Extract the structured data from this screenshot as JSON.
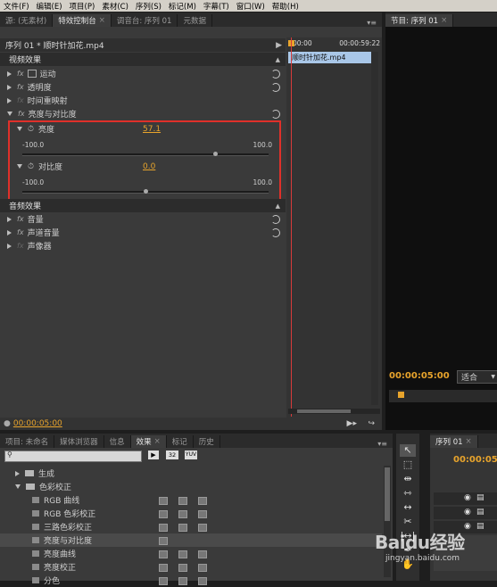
{
  "menu": [
    "文件(F)",
    "编辑(E)",
    "项目(P)",
    "素材(C)",
    "序列(S)",
    "标记(M)",
    "字幕(T)",
    "窗口(W)",
    "帮助(H)"
  ],
  "top_tabs": {
    "source": "源: (无素材)",
    "effect_controls": "特效控制台",
    "mixer": "调音台: 序列 01",
    "metadata": "元数据"
  },
  "program_tab": "节目: 序列 01",
  "effect_controls": {
    "clip_title": "序列 01 * 顺时针加花.mp4",
    "timecode_start": "00:00",
    "timecode_end": "00:00:59:22",
    "clip_bar_label": "顺时针加花.mp4",
    "video_header": "视频效果",
    "effects": [
      {
        "label": "运动"
      },
      {
        "label": "透明度"
      },
      {
        "label": "时间重映射"
      },
      {
        "label": "亮度与对比度"
      }
    ],
    "brightness": {
      "label": "亮度",
      "value": "57.1",
      "min": "-100.0",
      "max": "100.0",
      "level": 0.786
    },
    "contrast": {
      "label": "对比度",
      "value": "0.0",
      "min": "-100.0",
      "max": "100.0",
      "level": 0.5
    },
    "audio_header": "音频效果",
    "audio_effects": [
      {
        "label": "音量"
      },
      {
        "label": "声道音量"
      },
      {
        "label": "声像器"
      }
    ],
    "bottom_timecode": "00:00:05:00"
  },
  "program": {
    "timecode": "00:00:05:00",
    "fit": "适合"
  },
  "bottom_tabs": {
    "project": "项目: 未命名",
    "media": "媒体浏览器",
    "info": "信息",
    "effects": "效果",
    "markers": "标记",
    "history": "历史"
  },
  "effects_tree": {
    "folder_generate": "生成",
    "folder_color": "色彩校正",
    "items": [
      "RGB 曲线",
      "RGB 色彩校正",
      "三路色彩校正",
      "亮度与对比度",
      "亮度曲线",
      "亮度校正",
      "分色"
    ]
  },
  "sequence_panel": {
    "tab": "序列 01",
    "timecode": "00:00:05"
  },
  "watermark": {
    "brand": "Baidu经验",
    "url": "jingyan.baidu.com"
  }
}
